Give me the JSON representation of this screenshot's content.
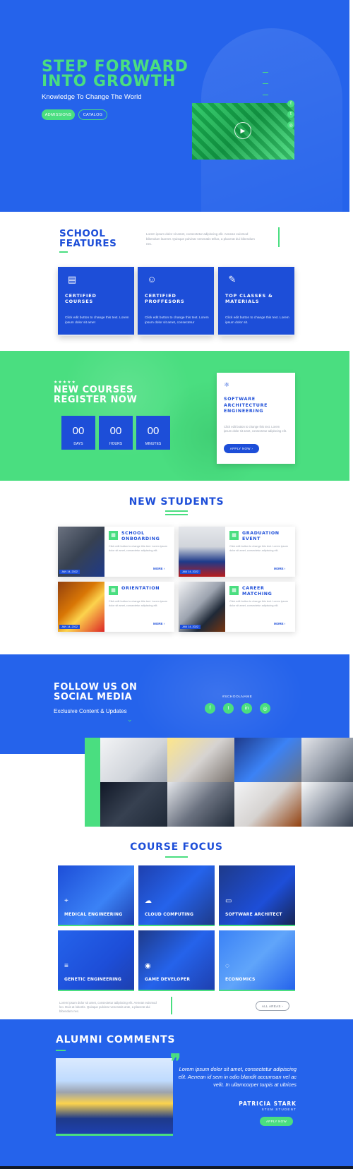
{
  "hero": {
    "title_line1": "STEP FORWARD",
    "title_line2": "INTO GROWTH",
    "subtitle": "Knowledge To Change The World",
    "btn_admissions": "Admissions",
    "btn_catalog": "Catalog",
    "play_icon": "play-icon",
    "social_icons": [
      "facebook-icon",
      "twitter-icon",
      "instagram-icon"
    ]
  },
  "features": {
    "title_line1": "SCHOOL",
    "title_line2": "FEATURES",
    "intro": "Lorem ipsum dolor sit amet, consectetur adipiscing elit. Aenean euismod bibendum laoreet. Quisque pulvinar venenatis tellus, a placerat dui bibendum nec.",
    "cards": [
      {
        "icon": "certificate-icon",
        "title_line1": "CERTIFIED",
        "title_line2": "COURSES",
        "text": "Click edit button to change this text. Lorem ipsum dolor sit amet"
      },
      {
        "icon": "professor-icon",
        "title_line1": "CERTIFIED",
        "title_line2": "PROFFESORS",
        "text": "Click edit button to change this text. Lorem ipsum dolor sit amet, consectetur"
      },
      {
        "icon": "materials-icon",
        "title_line1": "TOP CLASSES &",
        "title_line2": "MATERIALS",
        "text": "Click edit button to change this text. Lorem ipsum dolor sit."
      }
    ]
  },
  "courses": {
    "stars": "★★★★★",
    "title_line1": "NEW COURSES",
    "title_line2": "REGISTER NOW",
    "countdown": [
      {
        "value": "00",
        "label": "DAYS"
      },
      {
        "value": "00",
        "label": "HOURS"
      },
      {
        "value": "00",
        "label": "MINUTES"
      }
    ],
    "card": {
      "icon": "atom-icon",
      "title_line1": "SOFTWARE",
      "title_line2": "ARCHITECTURE",
      "title_line3": "ENGINEERING",
      "text": "Click edit button to change this text. Lorem ipsum dolor sit amet, consectetur adipiscing elit.",
      "button": "APPLY NOW ›"
    }
  },
  "new_students": {
    "title": "NEW STUDENTS",
    "items": [
      {
        "date": "JAN 14, 2022",
        "title_line1": "SCHOOL",
        "title_line2": "ONBOARDING",
        "text": "Click edit button to change this text. Lorem ipsum dolor sit amet, consectetur adipiscing elit.",
        "more": "MORE ›"
      },
      {
        "date": "JAN 14, 2022",
        "title_line1": "GRADUATION",
        "title_line2": "EVENT",
        "text": "Click edit button to change this text. Lorem ipsum dolor sit amet, consectetur adipiscing elit.",
        "more": "MORE ›"
      },
      {
        "date": "JAN 14, 2022",
        "title_line1": "ORIENTATION",
        "title_line2": "",
        "text": "Click edit button to change this text. Lorem ipsum dolor sit amet, consectetur adipiscing elit.",
        "more": "MORE ›"
      },
      {
        "date": "JAN 14, 2022",
        "title_line1": "CAREER",
        "title_line2": "MATCHING",
        "text": "Click edit button to change this text. Lorem ipsum dolor sit amet, consectetur adipiscing elit.",
        "more": "MORE ›"
      }
    ]
  },
  "social": {
    "title_line1": "FOLLOW US ON",
    "title_line2": "SOCIAL MEDIA",
    "subtitle": "Exclusive Content & Updates",
    "handle": "#SCHOOLNAME",
    "buttons": [
      {
        "icon": "facebook-icon",
        "glyph": "f"
      },
      {
        "icon": "twitter-icon",
        "glyph": "t"
      },
      {
        "icon": "linkedin-icon",
        "glyph": "in"
      },
      {
        "icon": "instagram-icon",
        "glyph": "◎"
      }
    ]
  },
  "course_focus": {
    "title": "COURSE FOCUS",
    "tiles": [
      {
        "icon": "plus-icon",
        "glyph": "+",
        "label": "MEDICAL ENGINEERING"
      },
      {
        "icon": "cloud-icon",
        "glyph": "☁",
        "label": "CLOUD COMPUTING"
      },
      {
        "icon": "devices-icon",
        "glyph": "▭",
        "label": "SOFTWARE ARCHITECT"
      },
      {
        "icon": "sliders-icon",
        "glyph": "≡",
        "label": "GENETIC ENGINEERING"
      },
      {
        "icon": "gamepad-icon",
        "glyph": "◉",
        "label": "GAME DEVELOPER"
      },
      {
        "icon": "chat-icon",
        "glyph": "◌",
        "label": "ECONOMICS"
      }
    ],
    "text": "Lorem ipsum dolor sit amet, consectetur adipiscing elit. Aenean euismod leo. Duis at lobortis. Quisque pulvinar venenatis ante, a placerat dui bibendum nec.",
    "button": "ALL AREAS ›"
  },
  "alumni": {
    "title": "ALUMNI COMMENTS",
    "quote": "Lorem ipsum dolor sit amet, consectetur adipiscing elit. Aenean id sem in odio blandit accumsan vel ac velit. In ullamcorper turpis at ultrices",
    "name": "PATRICIA STARK",
    "role": "STEM STUDENT",
    "button": "APPLY NOW"
  }
}
